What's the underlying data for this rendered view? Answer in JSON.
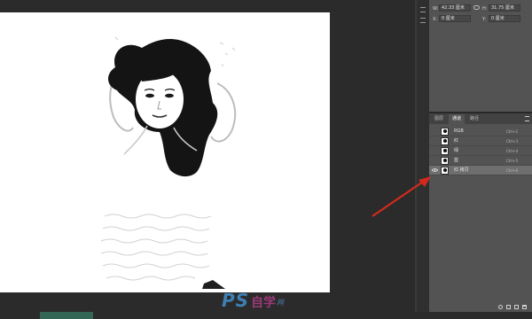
{
  "properties": {
    "w_label": "W:",
    "w_value": "42.33 厘米",
    "h_label": "H:",
    "h_value": "31.75 厘米",
    "x_label": "X:",
    "x_value": "0 厘米",
    "y_label": "Y:",
    "y_value": "0 厘米"
  },
  "channels_panel": {
    "tabs": [
      {
        "label": "图层",
        "active": false
      },
      {
        "label": "通道",
        "active": true
      },
      {
        "label": "路径",
        "active": false
      }
    ],
    "rows": [
      {
        "name": "RGB",
        "shortcut": "Ctrl+2",
        "visible": false,
        "selected": false
      },
      {
        "name": "红",
        "shortcut": "Ctrl+3",
        "visible": false,
        "selected": false
      },
      {
        "name": "绿",
        "shortcut": "Ctrl+4",
        "visible": false,
        "selected": false
      },
      {
        "name": "蓝",
        "shortcut": "Ctrl+5",
        "visible": false,
        "selected": false
      },
      {
        "name": "红 拷贝",
        "shortcut": "Ctrl+6",
        "visible": true,
        "selected": true
      }
    ]
  },
  "watermark": {
    "brand": "PS",
    "cn": "自学",
    "suffix": "网"
  },
  "colors": {
    "annotation_arrow": "#d42a1e",
    "panel_bg": "#535353",
    "selected_row": "#6e6e6e",
    "canvas_bg": "#2b2b2b"
  },
  "icons": [
    "link-icon",
    "eye-icon",
    "panel-menu-icon",
    "load-selection-icon",
    "save-selection-icon",
    "new-channel-icon",
    "delete-channel-icon"
  ]
}
